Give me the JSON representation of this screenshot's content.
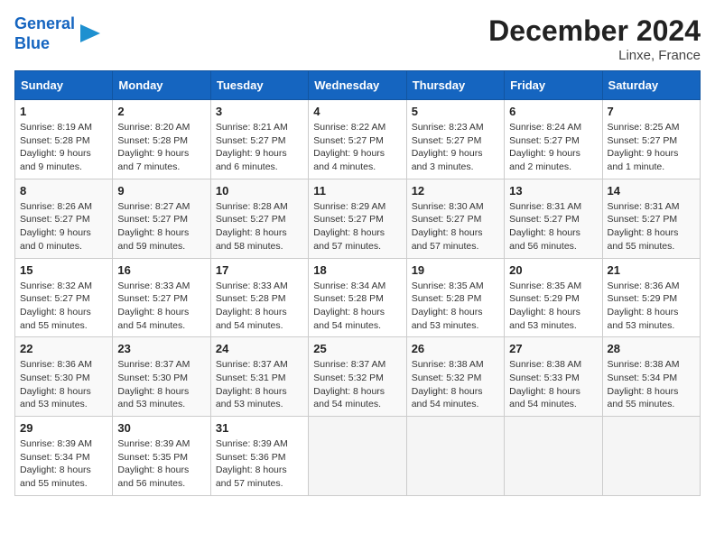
{
  "logo": {
    "line1": "General",
    "line2": "Blue"
  },
  "title": "December 2024",
  "subtitle": "Linxe, France",
  "weekdays": [
    "Sunday",
    "Monday",
    "Tuesday",
    "Wednesday",
    "Thursday",
    "Friday",
    "Saturday"
  ],
  "weeks": [
    [
      {
        "day": "1",
        "info": "Sunrise: 8:19 AM\nSunset: 5:28 PM\nDaylight: 9 hours\nand 9 minutes."
      },
      {
        "day": "2",
        "info": "Sunrise: 8:20 AM\nSunset: 5:28 PM\nDaylight: 9 hours\nand 7 minutes."
      },
      {
        "day": "3",
        "info": "Sunrise: 8:21 AM\nSunset: 5:27 PM\nDaylight: 9 hours\nand 6 minutes."
      },
      {
        "day": "4",
        "info": "Sunrise: 8:22 AM\nSunset: 5:27 PM\nDaylight: 9 hours\nand 4 minutes."
      },
      {
        "day": "5",
        "info": "Sunrise: 8:23 AM\nSunset: 5:27 PM\nDaylight: 9 hours\nand 3 minutes."
      },
      {
        "day": "6",
        "info": "Sunrise: 8:24 AM\nSunset: 5:27 PM\nDaylight: 9 hours\nand 2 minutes."
      },
      {
        "day": "7",
        "info": "Sunrise: 8:25 AM\nSunset: 5:27 PM\nDaylight: 9 hours\nand 1 minute."
      }
    ],
    [
      {
        "day": "8",
        "info": "Sunrise: 8:26 AM\nSunset: 5:27 PM\nDaylight: 9 hours\nand 0 minutes."
      },
      {
        "day": "9",
        "info": "Sunrise: 8:27 AM\nSunset: 5:27 PM\nDaylight: 8 hours\nand 59 minutes."
      },
      {
        "day": "10",
        "info": "Sunrise: 8:28 AM\nSunset: 5:27 PM\nDaylight: 8 hours\nand 58 minutes."
      },
      {
        "day": "11",
        "info": "Sunrise: 8:29 AM\nSunset: 5:27 PM\nDaylight: 8 hours\nand 57 minutes."
      },
      {
        "day": "12",
        "info": "Sunrise: 8:30 AM\nSunset: 5:27 PM\nDaylight: 8 hours\nand 57 minutes."
      },
      {
        "day": "13",
        "info": "Sunrise: 8:31 AM\nSunset: 5:27 PM\nDaylight: 8 hours\nand 56 minutes."
      },
      {
        "day": "14",
        "info": "Sunrise: 8:31 AM\nSunset: 5:27 PM\nDaylight: 8 hours\nand 55 minutes."
      }
    ],
    [
      {
        "day": "15",
        "info": "Sunrise: 8:32 AM\nSunset: 5:27 PM\nDaylight: 8 hours\nand 55 minutes."
      },
      {
        "day": "16",
        "info": "Sunrise: 8:33 AM\nSunset: 5:27 PM\nDaylight: 8 hours\nand 54 minutes."
      },
      {
        "day": "17",
        "info": "Sunrise: 8:33 AM\nSunset: 5:28 PM\nDaylight: 8 hours\nand 54 minutes."
      },
      {
        "day": "18",
        "info": "Sunrise: 8:34 AM\nSunset: 5:28 PM\nDaylight: 8 hours\nand 54 minutes."
      },
      {
        "day": "19",
        "info": "Sunrise: 8:35 AM\nSunset: 5:28 PM\nDaylight: 8 hours\nand 53 minutes."
      },
      {
        "day": "20",
        "info": "Sunrise: 8:35 AM\nSunset: 5:29 PM\nDaylight: 8 hours\nand 53 minutes."
      },
      {
        "day": "21",
        "info": "Sunrise: 8:36 AM\nSunset: 5:29 PM\nDaylight: 8 hours\nand 53 minutes."
      }
    ],
    [
      {
        "day": "22",
        "info": "Sunrise: 8:36 AM\nSunset: 5:30 PM\nDaylight: 8 hours\nand 53 minutes."
      },
      {
        "day": "23",
        "info": "Sunrise: 8:37 AM\nSunset: 5:30 PM\nDaylight: 8 hours\nand 53 minutes."
      },
      {
        "day": "24",
        "info": "Sunrise: 8:37 AM\nSunset: 5:31 PM\nDaylight: 8 hours\nand 53 minutes."
      },
      {
        "day": "25",
        "info": "Sunrise: 8:37 AM\nSunset: 5:32 PM\nDaylight: 8 hours\nand 54 minutes."
      },
      {
        "day": "26",
        "info": "Sunrise: 8:38 AM\nSunset: 5:32 PM\nDaylight: 8 hours\nand 54 minutes."
      },
      {
        "day": "27",
        "info": "Sunrise: 8:38 AM\nSunset: 5:33 PM\nDaylight: 8 hours\nand 54 minutes."
      },
      {
        "day": "28",
        "info": "Sunrise: 8:38 AM\nSunset: 5:34 PM\nDaylight: 8 hours\nand 55 minutes."
      }
    ],
    [
      {
        "day": "29",
        "info": "Sunrise: 8:39 AM\nSunset: 5:34 PM\nDaylight: 8 hours\nand 55 minutes."
      },
      {
        "day": "30",
        "info": "Sunrise: 8:39 AM\nSunset: 5:35 PM\nDaylight: 8 hours\nand 56 minutes."
      },
      {
        "day": "31",
        "info": "Sunrise: 8:39 AM\nSunset: 5:36 PM\nDaylight: 8 hours\nand 57 minutes."
      },
      {
        "day": "",
        "info": ""
      },
      {
        "day": "",
        "info": ""
      },
      {
        "day": "",
        "info": ""
      },
      {
        "day": "",
        "info": ""
      }
    ]
  ]
}
